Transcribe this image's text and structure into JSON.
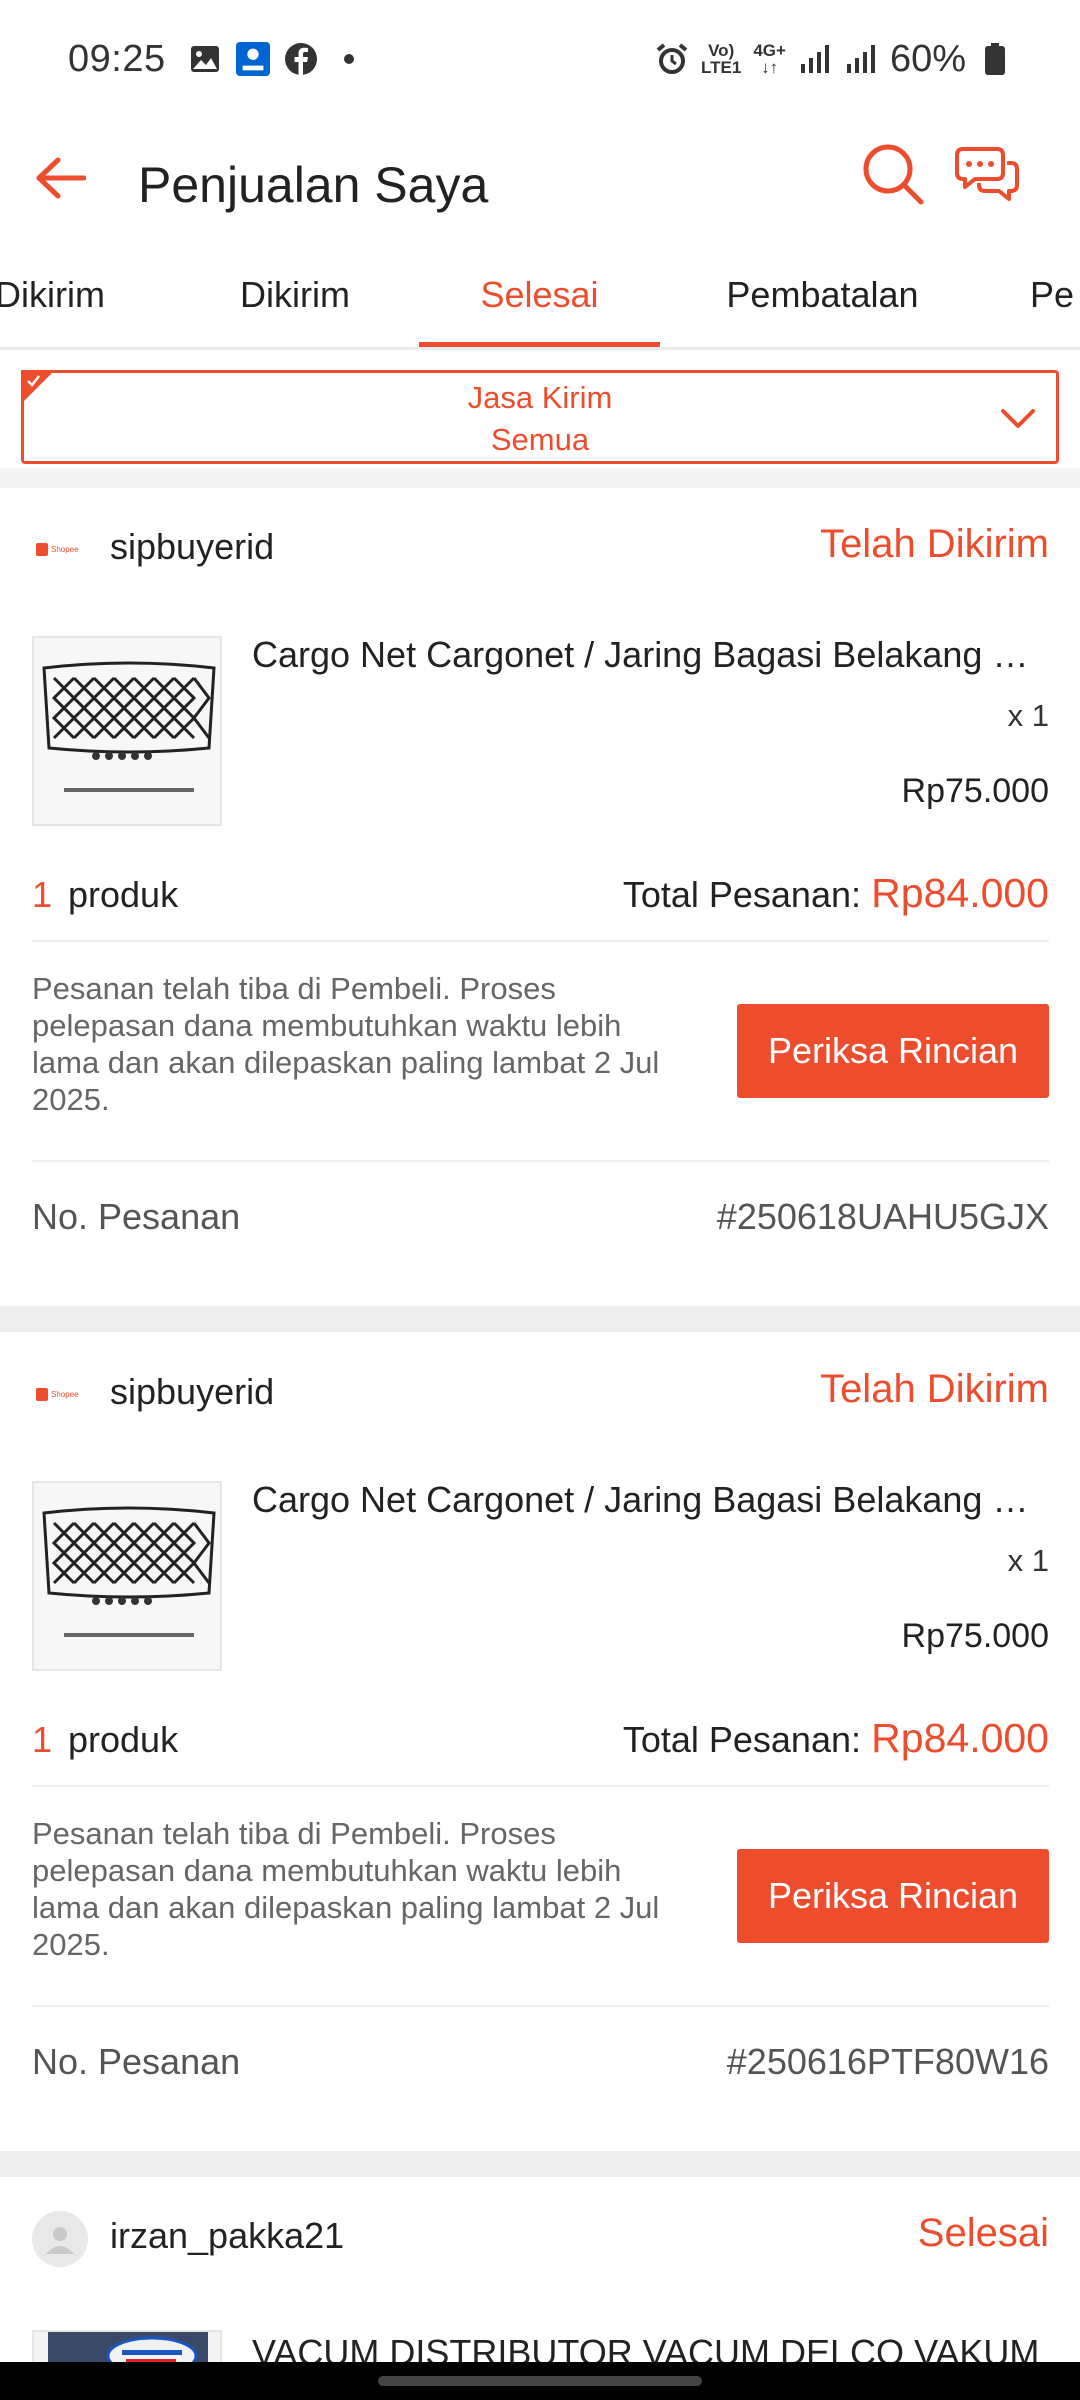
{
  "status_bar": {
    "time": "09:25",
    "battery": "60%",
    "net_top": "Vo)",
    "net_bottom": "LTE1",
    "net2_top": "4G+",
    "net2_bottom": "↓↑"
  },
  "header": {
    "title": "Penjualan Saya"
  },
  "tabs": [
    {
      "label": "Dikirim"
    },
    {
      "label": "Dikirim"
    },
    {
      "label": "Selesai",
      "active": true
    },
    {
      "label": "Pembatalan"
    },
    {
      "label": "Pe"
    }
  ],
  "filter": {
    "line1": "Jasa Kirim",
    "line2": "Semua"
  },
  "colors": {
    "accent": "#ee4d2d",
    "divider": "#eeeeee"
  },
  "orders": [
    {
      "shop_logo": "Shopee",
      "shop": "sipbuyerid",
      "status": "Telah Dikirim",
      "product_title": "Cargo Net Cargonet / Jaring Bagasi Belakang M...",
      "qty": "x 1",
      "unit_price": "Rp75.000",
      "count": "1",
      "count_label": "produk",
      "total_label": "Total Pesanan:",
      "total": "Rp84.000",
      "info": "Pesanan telah tiba di Pembeli. Proses pelepasan dana membutuhkan waktu lebih lama dan akan dilepaskan paling lambat 2 Jul 2025.",
      "button": "Periksa Rincian",
      "order_label": "No. Pesanan",
      "order_no": "#250618UAHU5GJX"
    },
    {
      "shop_logo": "Shopee",
      "shop": "sipbuyerid",
      "status": "Telah Dikirim",
      "product_title": "Cargo Net Cargonet / Jaring Bagasi Belakang M...",
      "qty": "x 1",
      "unit_price": "Rp75.000",
      "count": "1",
      "count_label": "produk",
      "total_label": "Total Pesanan:",
      "total": "Rp84.000",
      "info": "Pesanan telah tiba di Pembeli. Proses pelepasan dana membutuhkan waktu lebih lama dan akan dilepaskan paling lambat 2 Jul 2025.",
      "button": "Periksa Rincian",
      "order_label": "No. Pesanan",
      "order_no": "#250616PTF80W16"
    },
    {
      "shop": "irzan_pakka21",
      "status": "Selesai",
      "product_title": "VACUM DISTRIBUTOR VACUM DELCO VAKUM D..."
    }
  ]
}
